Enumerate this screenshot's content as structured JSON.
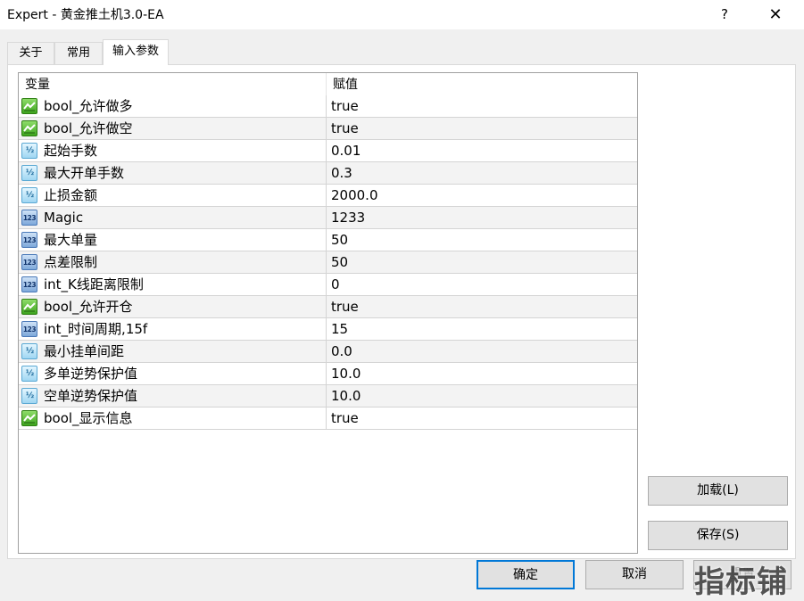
{
  "window": {
    "title": "Expert - 黄金推土机3.0-EA",
    "help_label": "?",
    "close_label": "✕"
  },
  "tabs": [
    {
      "label": "关于"
    },
    {
      "label": "常用"
    },
    {
      "label": "输入参数"
    }
  ],
  "grid": {
    "columns": [
      "变量",
      "赋值"
    ],
    "rows": [
      {
        "type": "bool",
        "name": "bool_允许做多",
        "value": "true"
      },
      {
        "type": "bool",
        "name": "bool_允许做空",
        "value": "true"
      },
      {
        "type": "double",
        "name": "起始手数",
        "value": "0.01"
      },
      {
        "type": "double",
        "name": "最大开单手数",
        "value": "0.3"
      },
      {
        "type": "double",
        "name": "止损金额",
        "value": "2000.0"
      },
      {
        "type": "int",
        "name": "Magic",
        "value": "1233"
      },
      {
        "type": "int",
        "name": "最大单量",
        "value": "50"
      },
      {
        "type": "int",
        "name": "点差限制",
        "value": "50"
      },
      {
        "type": "int",
        "name": "int_K线距离限制",
        "value": "0"
      },
      {
        "type": "bool",
        "name": "bool_允许开仓",
        "value": "true"
      },
      {
        "type": "int",
        "name": "int_时间周期,15f",
        "value": "15"
      },
      {
        "type": "double",
        "name": "最小挂单间距",
        "value": "0.0"
      },
      {
        "type": "double",
        "name": "多单逆势保护值",
        "value": "10.0"
      },
      {
        "type": "double",
        "name": "空单逆势保护值",
        "value": "10.0"
      },
      {
        "type": "bool",
        "name": "bool_显示信息",
        "value": "true"
      }
    ],
    "icon_labels": {
      "double": "½",
      "int": "123"
    }
  },
  "side_buttons": {
    "load_label": "加载(L)",
    "save_label": "保存(S)"
  },
  "bottom_buttons": {
    "ok_label": "确定",
    "cancel_label": "取消",
    "reset_label": "重置"
  },
  "watermark": "指标铺",
  "colors": {
    "focus_border": "#0078d7",
    "bool_icon": "#3fa51f",
    "double_icon": "#9fd6f2",
    "int_icon": "#7ea8da"
  }
}
